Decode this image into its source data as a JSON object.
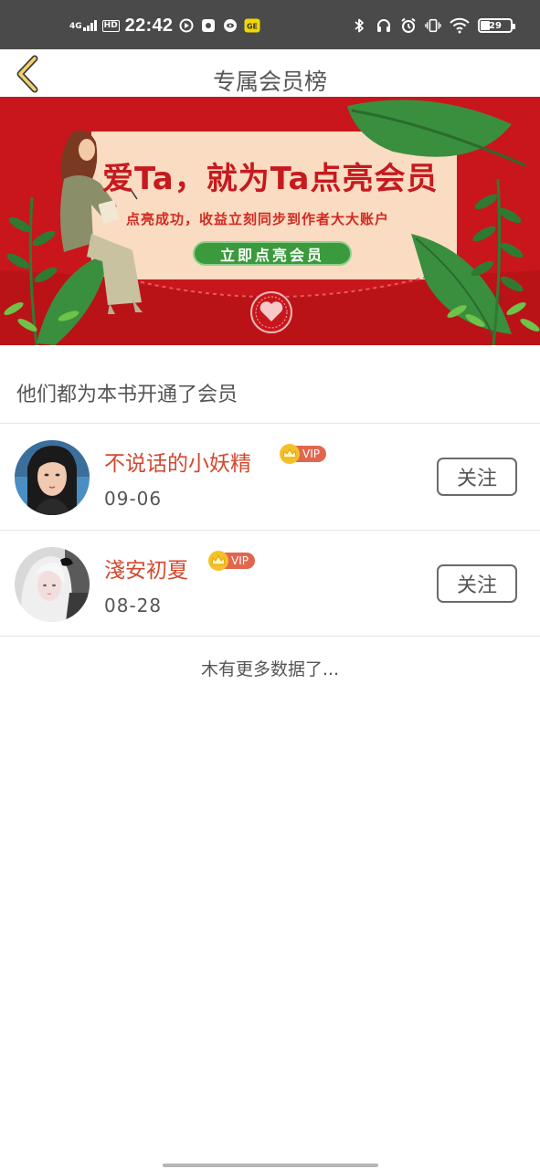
{
  "status_bar": {
    "network": "4G",
    "hd": "HD",
    "time": "22:42",
    "notif_badge": "GE",
    "battery": "29"
  },
  "header": {
    "title": "专属会员榜"
  },
  "banner": {
    "headline": "爱Ta，就为Ta点亮会员",
    "subline": "点亮成功，收益立刻同步到作者大大账户",
    "button": "立即点亮会员",
    "colors": {
      "red": "#c8161c",
      "paper": "#f9dcc2",
      "green": "#3a9a3c"
    }
  },
  "section": {
    "label": "他们都为本书开通了会员"
  },
  "members": [
    {
      "name": "不说话的小妖精",
      "vip": "VIP",
      "date": "09-06",
      "follow": "关注"
    },
    {
      "name": "淺安初夏",
      "vip": "VIP",
      "date": "08-28",
      "follow": "关注"
    }
  ],
  "footer": {
    "no_more": "木有更多数据了..."
  },
  "colors": {
    "name": "#d2492f",
    "vip_tag": "#e2664f",
    "crown": "#f5c02a",
    "status_bar": "#4a4a4a"
  }
}
